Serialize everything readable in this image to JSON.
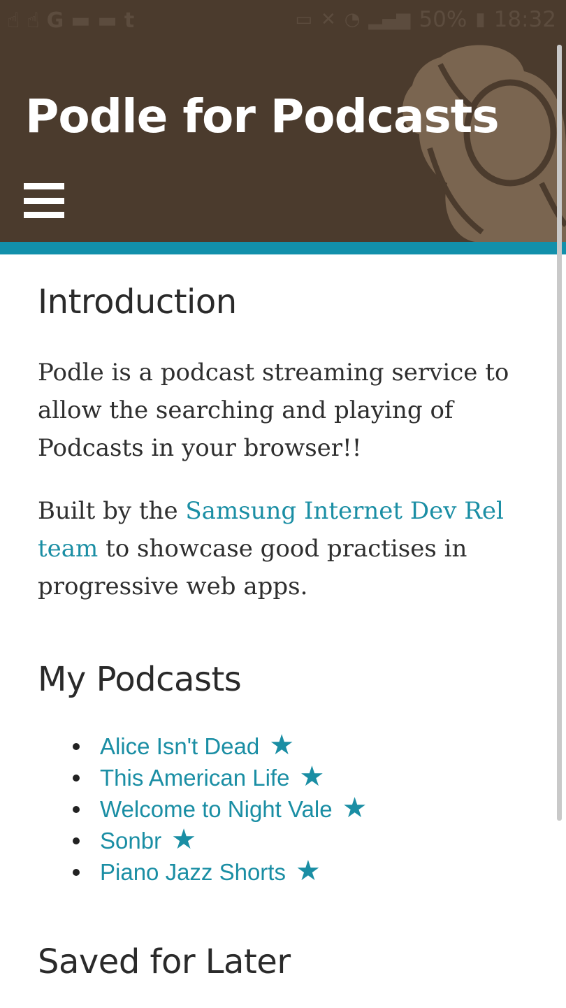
{
  "status_bar": {
    "left_icons": [
      "touch-icon",
      "touch-icon",
      "google-icon",
      "briefcase-icon",
      "briefcase-icon",
      "tumblr-icon"
    ],
    "google_glyph": "G",
    "tumblr_glyph": "t",
    "battery": "50%",
    "time": "18:32"
  },
  "header": {
    "title": "Podle for Podcasts",
    "background_color": "#4b3b2d",
    "accent_color": "#1290ab"
  },
  "intro": {
    "heading": "Introduction",
    "paragraph1": "Podle is a podcast streaming service to allow the searching and playing of Podcasts in your browser!!",
    "paragraph2_before": "Built by the ",
    "paragraph2_link": "Samsung Internet Dev Rel team",
    "paragraph2_after": " to showcase good practises in progressive web apps."
  },
  "my_podcasts": {
    "heading": "My Podcasts",
    "star_glyph": "★",
    "items": [
      {
        "title": "Alice Isn't Dead"
      },
      {
        "title": "This American Life"
      },
      {
        "title": "Welcome to Night Vale"
      },
      {
        "title": "Sonbr"
      },
      {
        "title": "Piano Jazz Shorts"
      }
    ]
  },
  "saved": {
    "heading": "Saved for Later"
  },
  "link_color": "#1a8ea4"
}
